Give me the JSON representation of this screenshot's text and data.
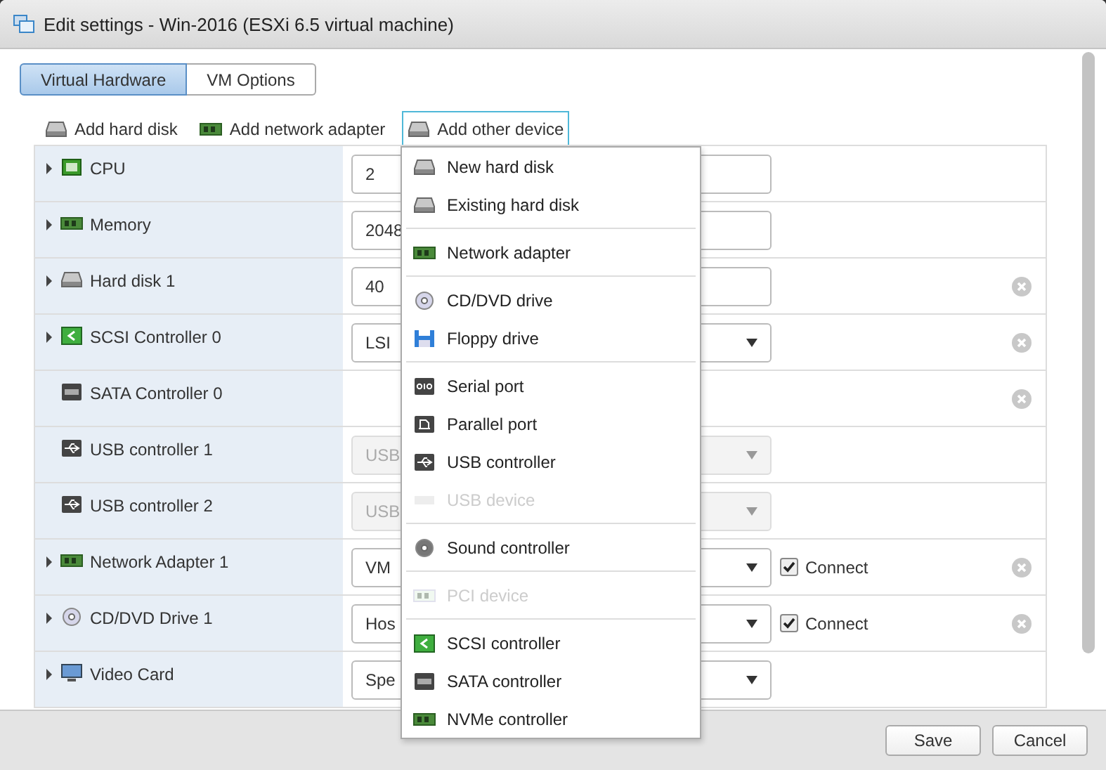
{
  "window": {
    "title": "Edit settings - Win-2016 (ESXi 6.5 virtual machine)"
  },
  "tabs": [
    {
      "label": "Virtual Hardware",
      "selected": true
    },
    {
      "label": "VM Options",
      "selected": false
    }
  ],
  "toolbar": [
    {
      "label": "Add hard disk",
      "open": false
    },
    {
      "label": "Add network adapter",
      "open": false
    },
    {
      "label": "Add other device",
      "open": true
    }
  ],
  "hardware": [
    {
      "name": "CPU",
      "expandable": true,
      "control": {
        "kind": "field",
        "value": "2",
        "disabled": false
      },
      "removable": false
    },
    {
      "name": "Memory",
      "expandable": true,
      "control": {
        "kind": "field",
        "value": "2048",
        "disabled": false
      },
      "removable": false
    },
    {
      "name": "Hard disk 1",
      "expandable": true,
      "control": {
        "kind": "field",
        "value": "40",
        "disabled": false
      },
      "removable": true
    },
    {
      "name": "SCSI Controller 0",
      "expandable": true,
      "control": {
        "kind": "select",
        "value": "LSI",
        "disabled": false
      },
      "removable": true
    },
    {
      "name": "SATA Controller 0",
      "expandable": false,
      "removable": true
    },
    {
      "name": "USB controller 1",
      "expandable": false,
      "control": {
        "kind": "select",
        "value": "USB",
        "disabled": true
      },
      "removable": false
    },
    {
      "name": "USB controller 2",
      "expandable": false,
      "control": {
        "kind": "select",
        "value": "USB",
        "disabled": true
      },
      "removable": false
    },
    {
      "name": "Network Adapter 1",
      "expandable": true,
      "control": {
        "kind": "select",
        "value": "VM",
        "disabled": false
      },
      "connect": {
        "label": "Connect",
        "checked": true
      },
      "removable": true
    },
    {
      "name": "CD/DVD Drive 1",
      "expandable": true,
      "control": {
        "kind": "select",
        "value": "Hos",
        "disabled": false
      },
      "connect": {
        "label": "Connect",
        "checked": true
      },
      "removable": true
    },
    {
      "name": "Video Card",
      "expandable": true,
      "control": {
        "kind": "select",
        "value": "Spe",
        "disabled": false
      },
      "removable": false
    }
  ],
  "device_menu": [
    [
      {
        "label": "New hard disk",
        "disabled": false
      },
      {
        "label": "Existing hard disk",
        "disabled": false
      }
    ],
    [
      {
        "label": "Network adapter",
        "disabled": false
      }
    ],
    [
      {
        "label": "CD/DVD drive",
        "disabled": false
      },
      {
        "label": "Floppy drive",
        "disabled": false
      }
    ],
    [
      {
        "label": "Serial port",
        "disabled": false
      },
      {
        "label": "Parallel port",
        "disabled": false
      },
      {
        "label": "USB controller",
        "disabled": false
      },
      {
        "label": "USB device",
        "disabled": true
      }
    ],
    [
      {
        "label": "Sound controller",
        "disabled": false
      }
    ],
    [
      {
        "label": "PCI device",
        "disabled": true
      }
    ],
    [
      {
        "label": "SCSI controller",
        "disabled": false
      },
      {
        "label": "SATA controller",
        "disabled": false
      },
      {
        "label": "NVMe controller",
        "disabled": false
      }
    ]
  ],
  "buttons": [
    "Save",
    "Cancel"
  ]
}
